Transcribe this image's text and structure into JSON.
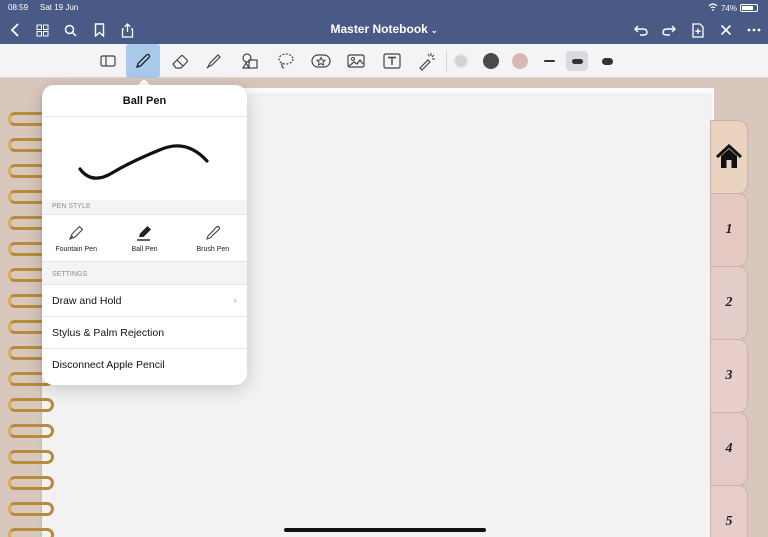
{
  "status": {
    "time": "08:59",
    "date": "Sat 19 Jun",
    "battery": "74%"
  },
  "nav": {
    "title": "Master Notebook"
  },
  "toolbar": {
    "tools": [
      "view-mode-icon",
      "pen-icon",
      "eraser-icon",
      "highlighter-icon",
      "shapes-icon",
      "lasso-icon",
      "sticker-icon",
      "image-icon",
      "text-icon",
      "laser-pointer-icon"
    ],
    "colors": [
      "#d2d2d2",
      "#4a4a4a",
      "#d7b9b4"
    ],
    "selected_tool": "pen-icon"
  },
  "popover": {
    "title": "Ball Pen",
    "pen_style_label": "PEN STYLE",
    "pen_styles": [
      {
        "label": "Fountain Pen"
      },
      {
        "label": "Ball Pen"
      },
      {
        "label": "Brush Pen"
      }
    ],
    "settings_label": "SETTINGS",
    "settings": [
      {
        "label": "Draw and Hold"
      },
      {
        "label": "Stylus & Palm Rejection"
      },
      {
        "label": "Disconnect Apple Pencil"
      }
    ]
  },
  "tabs": [
    {
      "label": ""
    },
    {
      "label": "1"
    },
    {
      "label": "2"
    },
    {
      "label": "3"
    },
    {
      "label": "4"
    },
    {
      "label": "5"
    }
  ],
  "colors": {
    "nav_bg": "#4a5a86",
    "active_tool": "#a9c9ea",
    "ring": "#b88a3e"
  }
}
